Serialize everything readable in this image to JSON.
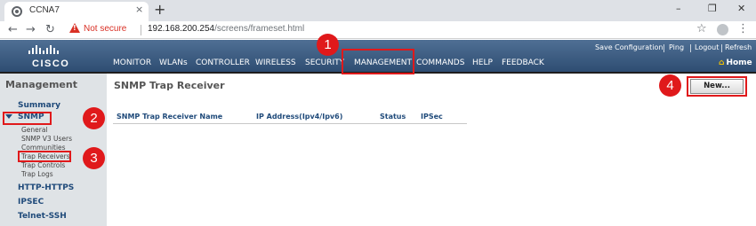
{
  "browser": {
    "tab_title": "CCNA7",
    "tab_close": "×",
    "new_tab": "+",
    "window_controls": {
      "minimize": "–",
      "restore": "❐",
      "close": "✕"
    },
    "nav": {
      "back": "←",
      "forward": "→",
      "reload": "↻"
    },
    "security_label": "Not secure",
    "url_host": "192.168.200.254",
    "url_path": "/screens/frameset.html",
    "star": "☆",
    "menu": "⋮"
  },
  "header": {
    "logo": "CISCO",
    "nav_items": [
      "MONITOR",
      "WLANs",
      "CONTROLLER",
      "WIRELESS",
      "SECURITY",
      "MANAGEMENT",
      "COMMANDS",
      "HELP",
      "FEEDBACK"
    ],
    "active_item": "MANAGEMENT",
    "top_links": [
      "Save Configuration",
      "Ping",
      "Logout",
      "Refresh"
    ],
    "home_label": "Home",
    "home_icon": "⌂"
  },
  "sidebar": {
    "title": "Management",
    "items": {
      "summary": "Summary",
      "snmp": "SNMP",
      "http_https": "HTTP-HTTPS",
      "ipsec": "IPSEC",
      "telnet_ssh": "Telnet-SSH"
    },
    "snmp_subitems": [
      "General",
      "SNMP V3 Users",
      "Communities",
      "Trap Receivers",
      "Trap Controls",
      "Trap Logs"
    ]
  },
  "main": {
    "title": "SNMP Trap Receiver",
    "new_button": "New...",
    "columns": [
      "SNMP Trap Receiver Name",
      "IP Address(Ipv4/Ipv6)",
      "Status",
      "IPSec"
    ]
  },
  "annotations": {
    "badges": [
      "1",
      "2",
      "3",
      "4"
    ],
    "color": "#e0191b"
  },
  "colors": {
    "header_top": "#4f6f94",
    "header_bottom": "#2e4d72",
    "sidebar_bg": "#dfe3e6",
    "link_blue": "#1f4a7a"
  }
}
